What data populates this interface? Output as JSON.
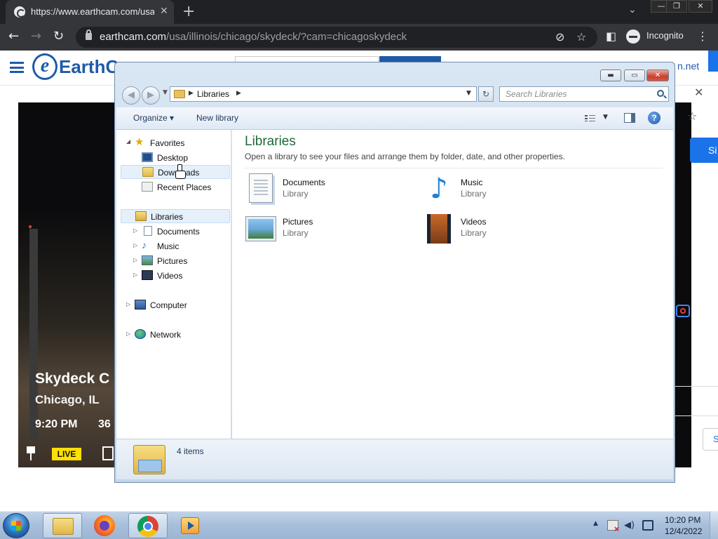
{
  "browser": {
    "tab_title": "https://www.earthcam.com/usa/ill",
    "tab_close": "✕",
    "new_tab": "+",
    "tab_search": "⌄",
    "url_host": "earthcam.com",
    "url_path": "/usa/illinois/chicago/skydeck/?cam=chicagoskydeck",
    "incognito_label": "Incognito",
    "back": "←",
    "forward": "→",
    "reload": "↻",
    "eye_off_icon": "⊘",
    "star_icon": "☆",
    "side_panel_icon": "◧",
    "menu": "⋮",
    "window_min": "—",
    "window_restore": "❐",
    "window_close": "✕"
  },
  "website": {
    "logo_letter": "e",
    "logo_text": "EarthC",
    "net_link": "n.net",
    "video": {
      "title": "Skydeck C",
      "location": "Chicago, IL",
      "time": "9:20 PM",
      "temperature": "36",
      "live_badge": "LIVE"
    },
    "side": {
      "close": "✕",
      "star": "☆",
      "sign_in": "Si",
      "s_button": "S"
    }
  },
  "explorer": {
    "buttons": {
      "minimize": "▬",
      "maximize": "▭",
      "close": "✕"
    },
    "nav": {
      "back": "◀",
      "forward": "▶",
      "dropdown": "▼",
      "refresh": "↻"
    },
    "address": {
      "arrow": "▶",
      "location": "Libraries",
      "dropdown": "▼"
    },
    "search_placeholder": "Search Libraries",
    "commands": {
      "organize": "Organize",
      "organize_arrow": "▾",
      "new_library": "New library",
      "view_dropdown": "▼",
      "help": "?"
    },
    "tree": {
      "favorites": "Favorites",
      "desktop": "Desktop",
      "downloads": "Downloads",
      "recent_places": "Recent Places",
      "libraries": "Libraries",
      "documents": "Documents",
      "music": "Music",
      "pictures": "Pictures",
      "videos": "Videos",
      "computer": "Computer",
      "network": "Network",
      "expanded_arrow": "◢",
      "collapsed_arrow": "▷",
      "star_glyph": "★",
      "note_glyph": "♪"
    },
    "content": {
      "heading": "Libraries",
      "description": "Open a library to see your files and arrange them by folder, date, and other properties.",
      "items": [
        {
          "name": "Documents",
          "type": "Library"
        },
        {
          "name": "Music",
          "type": "Library"
        },
        {
          "name": "Pictures",
          "type": "Library"
        },
        {
          "name": "Videos",
          "type": "Library"
        }
      ],
      "note_glyph": "♪"
    },
    "status": {
      "item_count": "4 items"
    }
  },
  "taskbar": {
    "tray_up": "▲",
    "speaker": "◀)",
    "time": "10:20 PM",
    "date": "12/4/2022"
  }
}
